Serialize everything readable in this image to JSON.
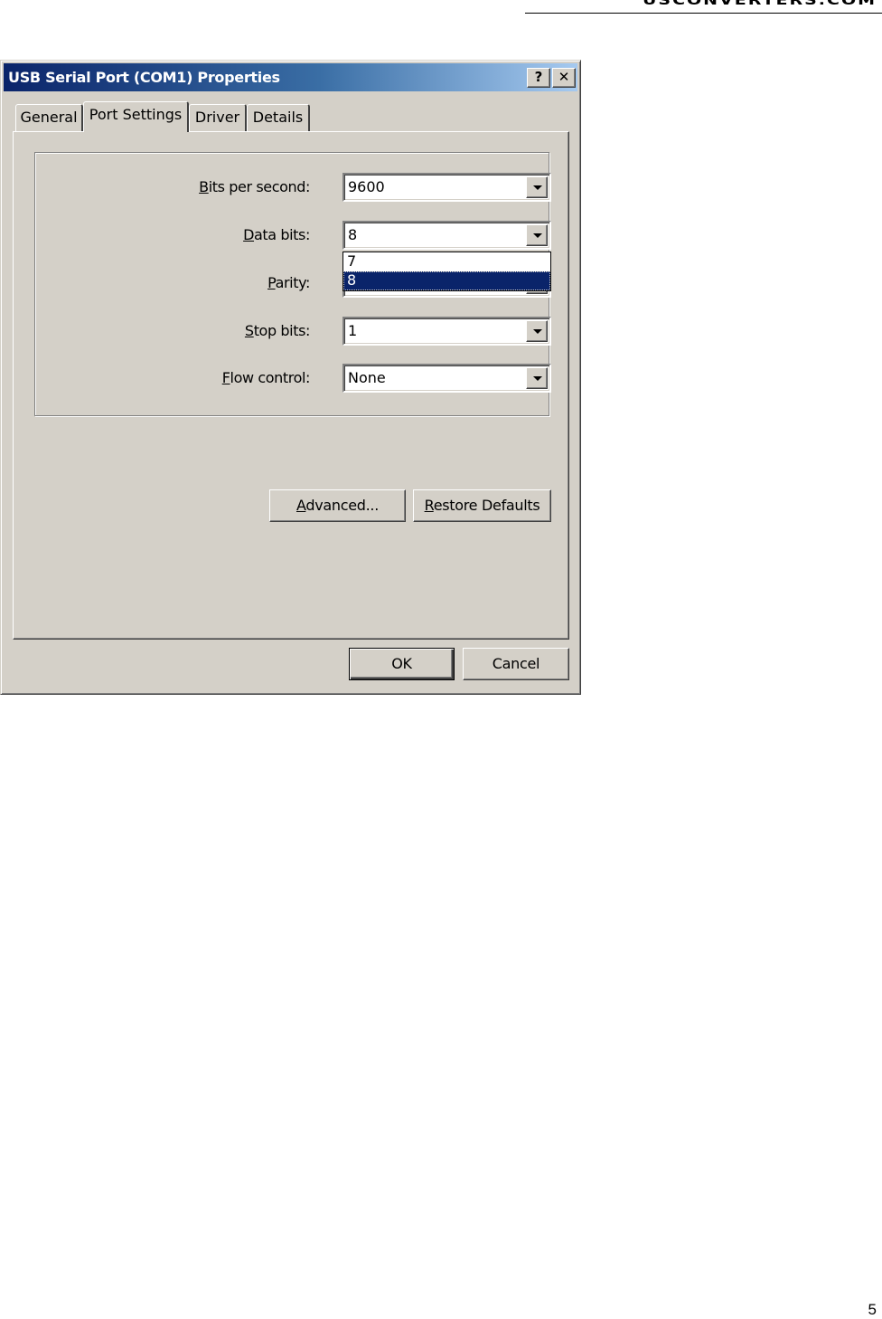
{
  "document": {
    "brand": "USCONVERTERS.COM",
    "page_number": "5"
  },
  "dialog": {
    "title": "USB Serial Port (COM1) Properties",
    "help_button": "?",
    "close_button": "✕",
    "tabs": [
      {
        "label": "General",
        "active": false
      },
      {
        "label": "Port Settings",
        "active": true
      },
      {
        "label": "Driver",
        "active": false
      },
      {
        "label": "Details",
        "active": false
      }
    ],
    "port_settings": {
      "bits_per_second": {
        "label_mn": "B",
        "label_rest": "its per second:",
        "value": "9600"
      },
      "data_bits": {
        "label_mn": "D",
        "label_rest": "ata bits:",
        "value": "8",
        "options": [
          "7",
          "8"
        ],
        "highlighted_option": "8"
      },
      "parity": {
        "label_mn": "P",
        "label_rest": "arity:",
        "value": ""
      },
      "stop_bits": {
        "label_mn": "S",
        "label_rest": "top bits:",
        "value": "1"
      },
      "flow_control": {
        "label_mn": "F",
        "label_rest": "low control:",
        "value": "None"
      }
    },
    "advanced_button": {
      "mn": "A",
      "rest": "dvanced..."
    },
    "restore_button": {
      "mn": "R",
      "rest": "estore Defaults"
    },
    "ok_button": "OK",
    "cancel_button": "Cancel"
  }
}
